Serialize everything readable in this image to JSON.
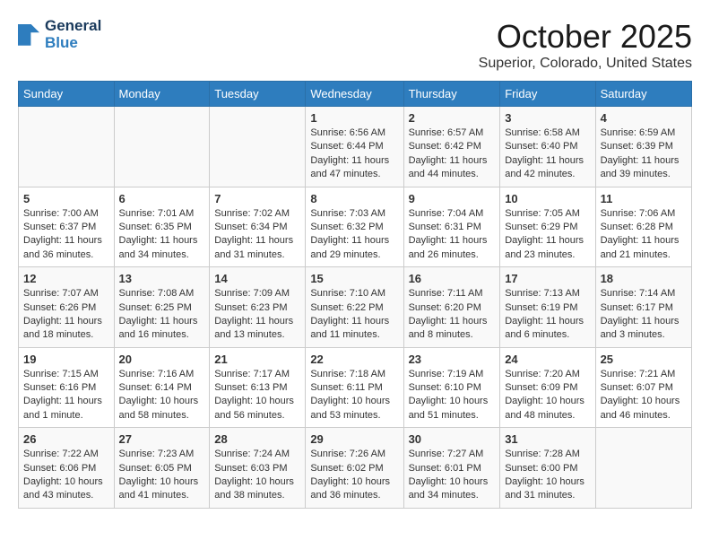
{
  "header": {
    "logo_line1": "General",
    "logo_line2": "Blue",
    "month_title": "October 2025",
    "location": "Superior, Colorado, United States"
  },
  "days_of_week": [
    "Sunday",
    "Monday",
    "Tuesday",
    "Wednesday",
    "Thursday",
    "Friday",
    "Saturday"
  ],
  "weeks": [
    [
      {
        "day": "",
        "info": ""
      },
      {
        "day": "",
        "info": ""
      },
      {
        "day": "",
        "info": ""
      },
      {
        "day": "1",
        "info": "Sunrise: 6:56 AM\nSunset: 6:44 PM\nDaylight: 11 hours and 47 minutes."
      },
      {
        "day": "2",
        "info": "Sunrise: 6:57 AM\nSunset: 6:42 PM\nDaylight: 11 hours and 44 minutes."
      },
      {
        "day": "3",
        "info": "Sunrise: 6:58 AM\nSunset: 6:40 PM\nDaylight: 11 hours and 42 minutes."
      },
      {
        "day": "4",
        "info": "Sunrise: 6:59 AM\nSunset: 6:39 PM\nDaylight: 11 hours and 39 minutes."
      }
    ],
    [
      {
        "day": "5",
        "info": "Sunrise: 7:00 AM\nSunset: 6:37 PM\nDaylight: 11 hours and 36 minutes."
      },
      {
        "day": "6",
        "info": "Sunrise: 7:01 AM\nSunset: 6:35 PM\nDaylight: 11 hours and 34 minutes."
      },
      {
        "day": "7",
        "info": "Sunrise: 7:02 AM\nSunset: 6:34 PM\nDaylight: 11 hours and 31 minutes."
      },
      {
        "day": "8",
        "info": "Sunrise: 7:03 AM\nSunset: 6:32 PM\nDaylight: 11 hours and 29 minutes."
      },
      {
        "day": "9",
        "info": "Sunrise: 7:04 AM\nSunset: 6:31 PM\nDaylight: 11 hours and 26 minutes."
      },
      {
        "day": "10",
        "info": "Sunrise: 7:05 AM\nSunset: 6:29 PM\nDaylight: 11 hours and 23 minutes."
      },
      {
        "day": "11",
        "info": "Sunrise: 7:06 AM\nSunset: 6:28 PM\nDaylight: 11 hours and 21 minutes."
      }
    ],
    [
      {
        "day": "12",
        "info": "Sunrise: 7:07 AM\nSunset: 6:26 PM\nDaylight: 11 hours and 18 minutes."
      },
      {
        "day": "13",
        "info": "Sunrise: 7:08 AM\nSunset: 6:25 PM\nDaylight: 11 hours and 16 minutes."
      },
      {
        "day": "14",
        "info": "Sunrise: 7:09 AM\nSunset: 6:23 PM\nDaylight: 11 hours and 13 minutes."
      },
      {
        "day": "15",
        "info": "Sunrise: 7:10 AM\nSunset: 6:22 PM\nDaylight: 11 hours and 11 minutes."
      },
      {
        "day": "16",
        "info": "Sunrise: 7:11 AM\nSunset: 6:20 PM\nDaylight: 11 hours and 8 minutes."
      },
      {
        "day": "17",
        "info": "Sunrise: 7:13 AM\nSunset: 6:19 PM\nDaylight: 11 hours and 6 minutes."
      },
      {
        "day": "18",
        "info": "Sunrise: 7:14 AM\nSunset: 6:17 PM\nDaylight: 11 hours and 3 minutes."
      }
    ],
    [
      {
        "day": "19",
        "info": "Sunrise: 7:15 AM\nSunset: 6:16 PM\nDaylight: 11 hours and 1 minute."
      },
      {
        "day": "20",
        "info": "Sunrise: 7:16 AM\nSunset: 6:14 PM\nDaylight: 10 hours and 58 minutes."
      },
      {
        "day": "21",
        "info": "Sunrise: 7:17 AM\nSunset: 6:13 PM\nDaylight: 10 hours and 56 minutes."
      },
      {
        "day": "22",
        "info": "Sunrise: 7:18 AM\nSunset: 6:11 PM\nDaylight: 10 hours and 53 minutes."
      },
      {
        "day": "23",
        "info": "Sunrise: 7:19 AM\nSunset: 6:10 PM\nDaylight: 10 hours and 51 minutes."
      },
      {
        "day": "24",
        "info": "Sunrise: 7:20 AM\nSunset: 6:09 PM\nDaylight: 10 hours and 48 minutes."
      },
      {
        "day": "25",
        "info": "Sunrise: 7:21 AM\nSunset: 6:07 PM\nDaylight: 10 hours and 46 minutes."
      }
    ],
    [
      {
        "day": "26",
        "info": "Sunrise: 7:22 AM\nSunset: 6:06 PM\nDaylight: 10 hours and 43 minutes."
      },
      {
        "day": "27",
        "info": "Sunrise: 7:23 AM\nSunset: 6:05 PM\nDaylight: 10 hours and 41 minutes."
      },
      {
        "day": "28",
        "info": "Sunrise: 7:24 AM\nSunset: 6:03 PM\nDaylight: 10 hours and 38 minutes."
      },
      {
        "day": "29",
        "info": "Sunrise: 7:26 AM\nSunset: 6:02 PM\nDaylight: 10 hours and 36 minutes."
      },
      {
        "day": "30",
        "info": "Sunrise: 7:27 AM\nSunset: 6:01 PM\nDaylight: 10 hours and 34 minutes."
      },
      {
        "day": "31",
        "info": "Sunrise: 7:28 AM\nSunset: 6:00 PM\nDaylight: 10 hours and 31 minutes."
      },
      {
        "day": "",
        "info": ""
      }
    ]
  ]
}
